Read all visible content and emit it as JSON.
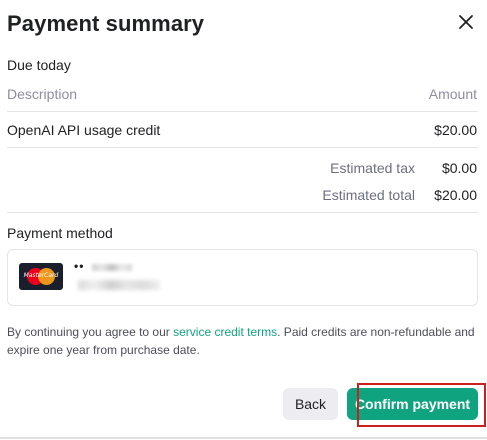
{
  "dialog": {
    "title": "Payment summary",
    "close_icon": "close-icon"
  },
  "due_today": {
    "heading": "Due today",
    "columns": {
      "description": "Description",
      "amount": "Amount"
    },
    "items": [
      {
        "description": "OpenAI API usage credit",
        "amount": "$20.00"
      }
    ],
    "estimated_tax_label": "Estimated tax",
    "estimated_tax_value": "$0.00",
    "estimated_total_label": "Estimated total",
    "estimated_total_value": "$20.00"
  },
  "payment_method": {
    "heading": "Payment method",
    "card_brand": "MasterCard",
    "card_mask": "••"
  },
  "terms": {
    "prefix": "By continuing you agree to our ",
    "link": "service credit terms",
    "suffix": ". Paid credits are non-refundable and expire one year from purchase date."
  },
  "buttons": {
    "back": "Back",
    "confirm": "Confirm payment"
  },
  "colors": {
    "accent": "#10a37f",
    "highlight": "#cc1f1f",
    "secondary_button": "#ececf1"
  }
}
